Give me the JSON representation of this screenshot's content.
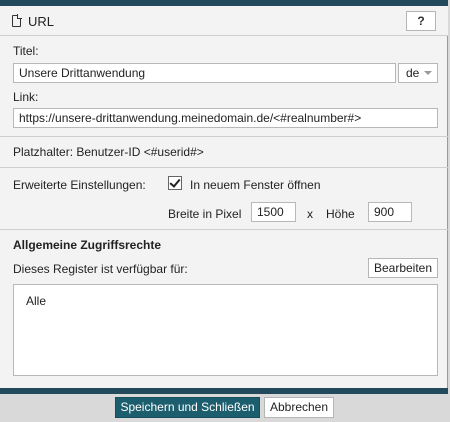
{
  "header": {
    "title": "URL",
    "help_label": "?"
  },
  "title_field": {
    "label": "Titel:",
    "value": "Unsere Drittanwendung",
    "lang": "de"
  },
  "link_field": {
    "label": "Link:",
    "value": "https://unsere-drittanwendung.meinedomain.de/<#realnumber#>"
  },
  "placeholder_info": "Platzhalter: Benutzer-ID <#userid#>",
  "advanced": {
    "label": "Erweiterte Einstellungen:",
    "new_window_label": "In neuem Fenster öffnen",
    "new_window_checked": true,
    "width_label": "Breite in Pixel",
    "width_value": "1500",
    "x_label": "x",
    "height_label": "Höhe",
    "height_value": "900"
  },
  "access": {
    "heading": "Allgemeine Zugriffsrechte",
    "available_label": "Dieses Register ist verfügbar für:",
    "edit_label": "Bearbeiten",
    "value": "Alle"
  },
  "footer": {
    "save_label": "Speichern und Schließen",
    "cancel_label": "Abbrechen"
  },
  "colors": {
    "accent": "#1d5e6e",
    "bar": "#234a5c"
  }
}
